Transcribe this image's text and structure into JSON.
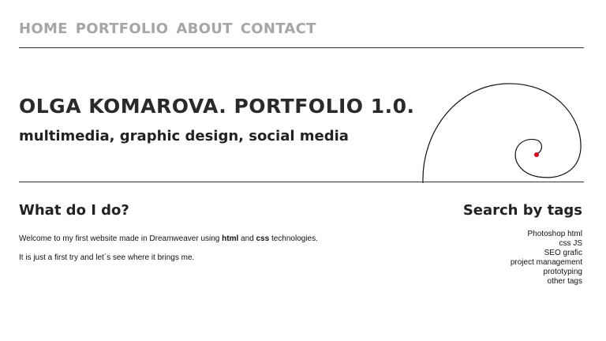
{
  "nav": {
    "items": [
      {
        "label": "HOME"
      },
      {
        "label": "PORTFOLIO"
      },
      {
        "label": "ABOUT"
      },
      {
        "label": "CONTACT"
      }
    ]
  },
  "header": {
    "title": "OLGA KOMAROVA. PORTFOLIO 1.0.",
    "subtitle": "multimedia, graphic design, social media"
  },
  "about": {
    "heading": "What do I do?",
    "p1_before": "Welcome to my first website made in Dreamweaver using ",
    "p1_html": "html",
    "p1_and": " and ",
    "p1_css": "css",
    "p1_after": " technologies.",
    "p2": "It is just a first try and let´s see where it brings me."
  },
  "tags": {
    "heading": "Search by tags",
    "items": [
      {
        "label": "Photoshop html"
      },
      {
        "label": "css JS"
      },
      {
        "label": "SEO grafic"
      },
      {
        "label": "project management"
      },
      {
        "label": "prototyping"
      },
      {
        "label": "other tags"
      }
    ]
  },
  "colors": {
    "nav_text": "#a6a6a6",
    "heading_text": "#222222",
    "spiral_dot": "#e0001a"
  }
}
